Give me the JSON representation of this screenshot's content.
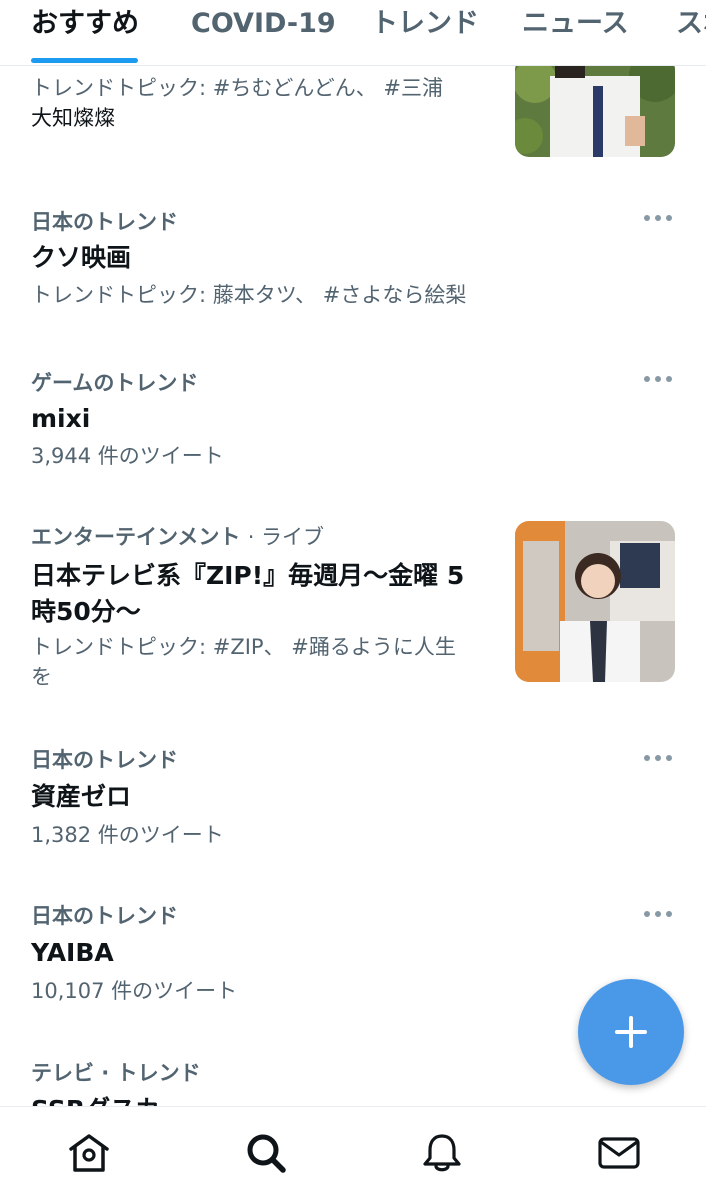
{
  "tabs": [
    {
      "label": "おすすめ",
      "active": true
    },
    {
      "label": "COVID-19"
    },
    {
      "label": "トレンド"
    },
    {
      "label": "ニュース"
    },
    {
      "label": "スポ"
    }
  ],
  "trends": [
    {
      "meta": "トレンドトピック: #ちむどんどん、 #三浦",
      "meta2": "大知燦燦"
    },
    {
      "context": "日本のトレンド",
      "title": "クソ映画",
      "meta": "トレンドトピック: 藤本タツ、 #さよなら絵梨"
    },
    {
      "context": "ゲームのトレンド",
      "title": "mixi",
      "meta": "3,944 件のツイート"
    },
    {
      "context": "エンターテインメント",
      "live": "· ライブ",
      "title": "日本テレビ系『ZIP!』毎週月〜金曜 5",
      "title2": "時50分〜",
      "meta": "トレンドトピック: #ZIP、 #踊るように人生",
      "meta2": "を"
    },
    {
      "context": "日本のトレンド",
      "title": "資産ゼロ",
      "meta": "1,382 件のツイート"
    },
    {
      "context": "日本のトレンド",
      "title": "YAIBA",
      "meta": "10,107 件のツイート"
    },
    {
      "context": "テレビ · トレンド",
      "title": "SSRダスカ"
    }
  ],
  "icons": {
    "more": "more-icon",
    "compose": "plus-icon",
    "home": "home-icon",
    "search": "search-icon",
    "notifications": "bell-icon",
    "messages": "mail-icon"
  },
  "colors": {
    "accent": "#1d9bf0",
    "fab": "#4a99e9",
    "secondary_text": "#536471"
  }
}
